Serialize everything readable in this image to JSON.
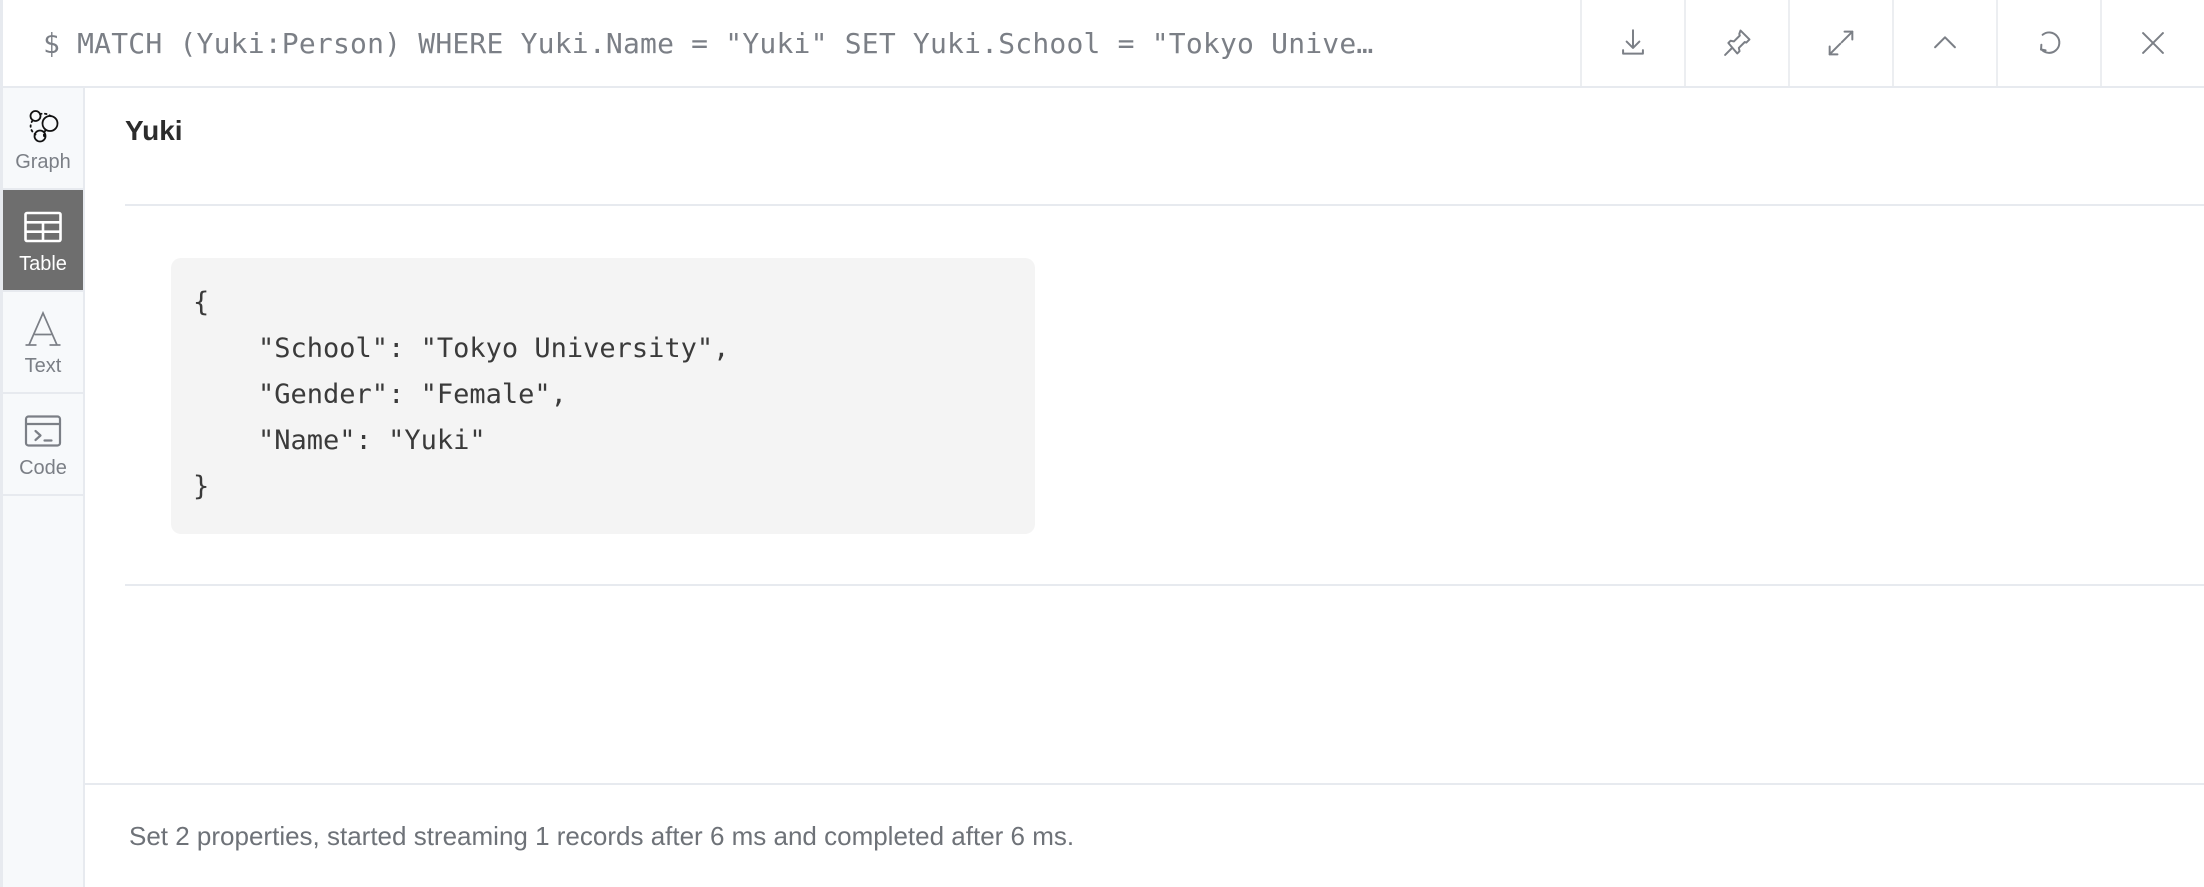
{
  "query_bar": {
    "prompt": "$",
    "query": "MATCH (Yuki:Person) WHERE Yuki.Name = \"Yuki\" SET Yuki.School = \"Tokyo Unive…",
    "full_text": "$ MATCH (Yuki:Person) WHERE Yuki.Name = \"Yuki\" SET Yuki.School = \"Tokyo Unive…",
    "buttons": [
      {
        "name": "download-icon",
        "label": "Download"
      },
      {
        "name": "pin-icon",
        "label": "Pin"
      },
      {
        "name": "expand-icon",
        "label": "Expand"
      },
      {
        "name": "chevron-up-icon",
        "label": "Collapse"
      },
      {
        "name": "refresh-icon",
        "label": "Rerun"
      },
      {
        "name": "close-icon",
        "label": "Close"
      }
    ]
  },
  "sidebar": {
    "items": [
      {
        "label": "Graph",
        "icon": "graph-icon",
        "selected": false
      },
      {
        "label": "Table",
        "icon": "table-icon",
        "selected": true
      },
      {
        "label": "Text",
        "icon": "text-icon",
        "selected": false
      },
      {
        "label": "Code",
        "icon": "code-icon",
        "selected": false
      }
    ]
  },
  "result": {
    "record_title": "Yuki",
    "json_lines": [
      "{",
      "    \"School\": \"Tokyo University\",",
      "    \"Gender\": \"Female\",",
      "    \"Name\": \"Yuki\"",
      "}"
    ]
  },
  "status": {
    "message": "Set 2 properties, started streaming 1 records after 6 ms and completed after 6 ms."
  },
  "colors": {
    "selected_sidebar_bg": "#6e6e6e",
    "sidebar_bg": "#f7f9fb",
    "border": "#e7eaef",
    "code_bg": "#f4f4f4",
    "muted_text": "#7b7f86"
  }
}
